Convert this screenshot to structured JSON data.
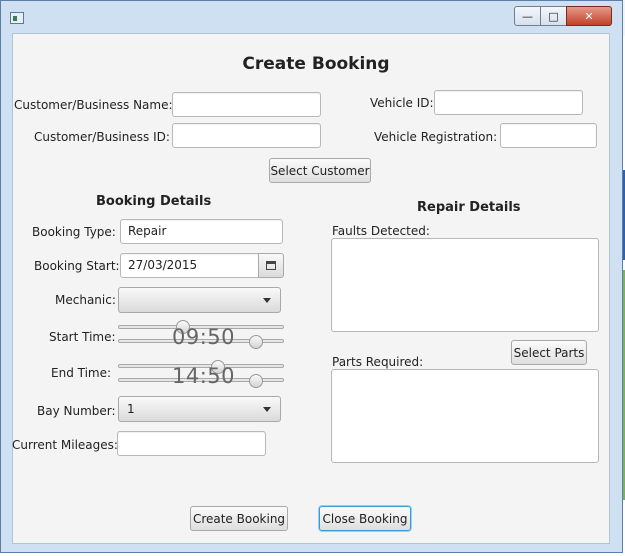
{
  "window": {
    "minimize_glyph": "—",
    "maximize_glyph": "□",
    "close_glyph": "✕"
  },
  "form": {
    "title": "Create Booking",
    "customer_name_label": "Customer/Business Name:",
    "customer_name_value": "",
    "customer_id_label": "Customer/Business ID:",
    "customer_id_value": "",
    "vehicle_id_label": "Vehicle ID:",
    "vehicle_id_value": "",
    "vehicle_reg_label": "Vehicle Registration:",
    "vehicle_reg_value": "",
    "select_customer_button": "Select Customer"
  },
  "booking": {
    "heading": "Booking Details",
    "type_label": "Booking Type:",
    "type_value": "Repair",
    "start_label": "Booking Start:",
    "start_value": "27/03/2015",
    "mechanic_label": "Mechanic:",
    "mechanic_value": "",
    "start_time_label": "Start Time:",
    "start_time_value": "09:50",
    "end_time_label": "End Time:",
    "end_time_value": "14:50",
    "bay_label": "Bay Number:",
    "bay_value": "1",
    "mileage_label": "Current Mileages:",
    "mileage_value": ""
  },
  "repair": {
    "heading": "Repair Details",
    "faults_label": "Faults Detected:",
    "faults_value": "",
    "select_parts_button": "Select Parts",
    "parts_label": "Parts Required:",
    "parts_value": ""
  },
  "actions": {
    "create_button": "Create Booking",
    "close_button": "Close Booking"
  }
}
